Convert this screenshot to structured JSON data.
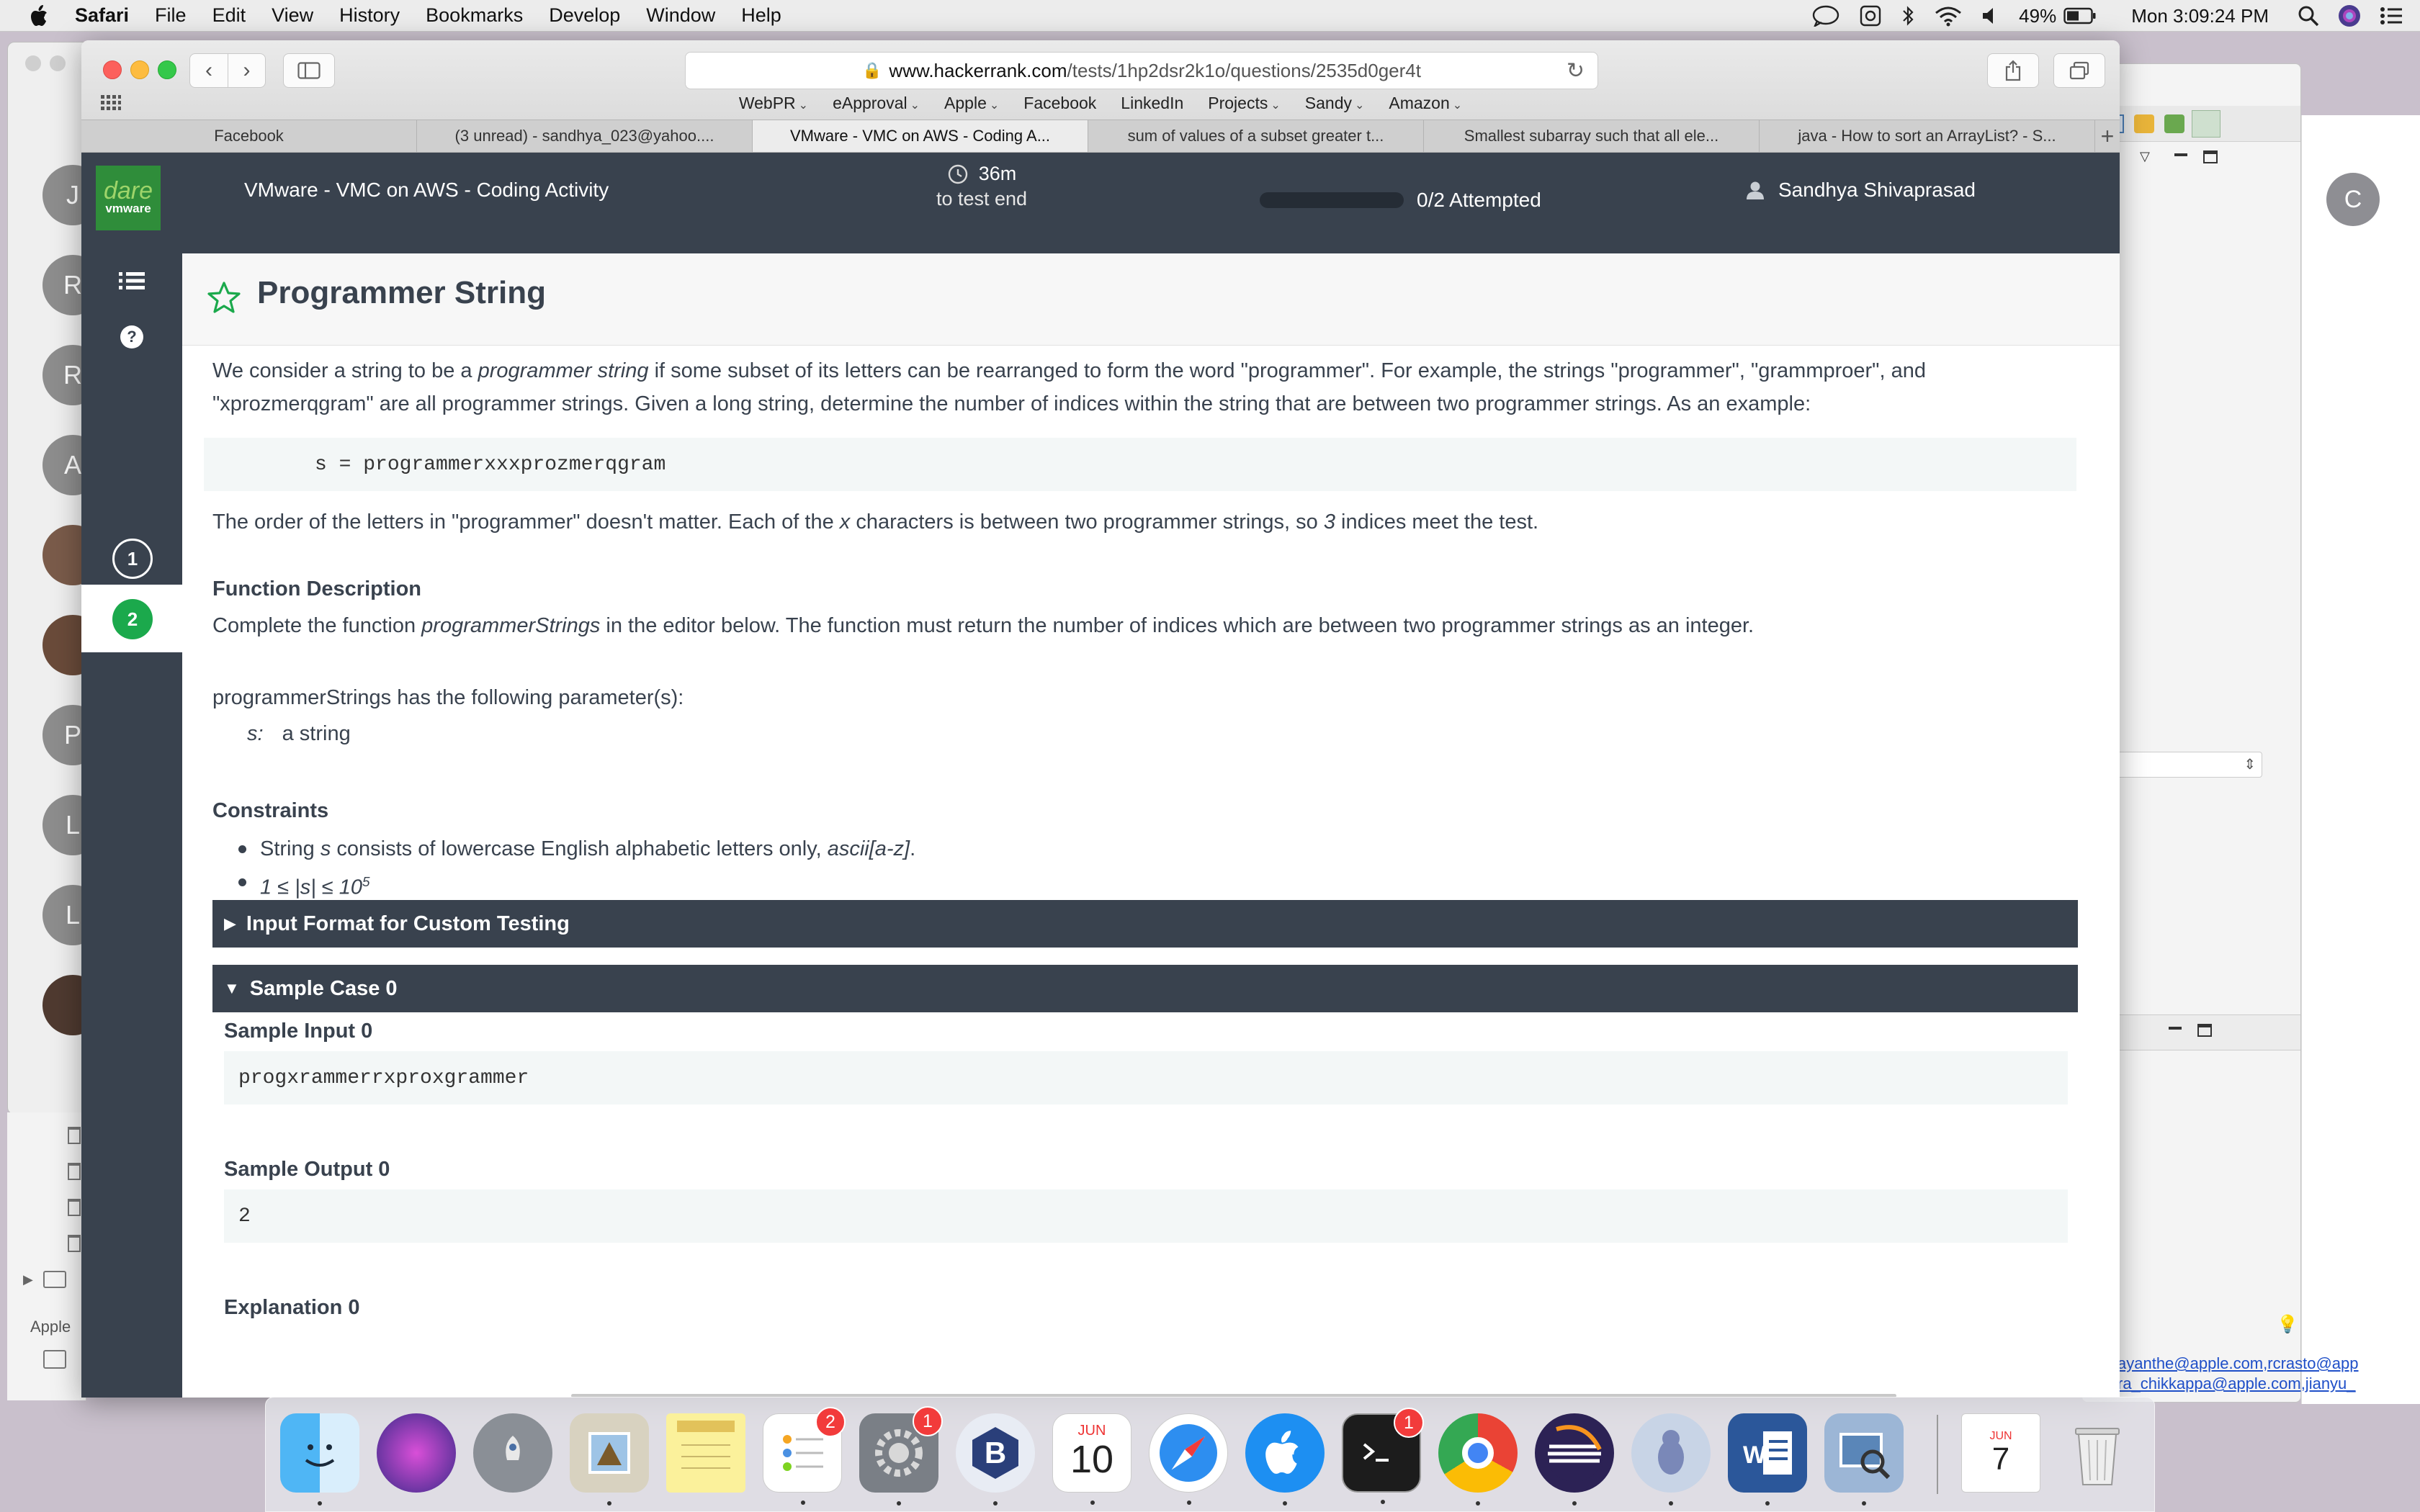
{
  "menubar": {
    "app": "Safari",
    "items": [
      "File",
      "Edit",
      "View",
      "History",
      "Bookmarks",
      "Develop",
      "Window",
      "Help"
    ],
    "battery": "49%",
    "clock": "Mon 3:09:24 PM"
  },
  "background": {
    "left_avatars": [
      "J",
      "R",
      "R",
      "A",
      "",
      "",
      "P",
      "L",
      "L",
      ""
    ],
    "apple_label": "Apple",
    "right_avatar": "C",
    "emails": [
      "ayanthe@apple.com,rcrasto@app",
      "ra_chikkappa@apple.com,jianyu_"
    ]
  },
  "browser": {
    "address_domain": "www.hackerrank.com",
    "address_path": "/tests/1hp2dsr2k1o/questions/2535d0ger4t",
    "favorites": [
      {
        "label": "WebPR",
        "menu": true
      },
      {
        "label": "eApproval",
        "menu": true
      },
      {
        "label": "Apple",
        "menu": true
      },
      {
        "label": "Facebook",
        "menu": false
      },
      {
        "label": "LinkedIn",
        "menu": false
      },
      {
        "label": "Projects",
        "menu": true
      },
      {
        "label": "Sandy",
        "menu": true
      },
      {
        "label": "Amazon",
        "menu": true
      }
    ],
    "tabs": [
      {
        "label": "Facebook",
        "active": false
      },
      {
        "label": "(3 unread) - sandhya_023@yahoo....",
        "active": false
      },
      {
        "label": "VMware - VMC on AWS - Coding A...",
        "active": true
      },
      {
        "label": "sum of values of a subset greater t...",
        "active": false
      },
      {
        "label": "Smallest subarray such that all ele...",
        "active": false
      },
      {
        "label": "java - How to sort an ArrayList? - S...",
        "active": false
      }
    ]
  },
  "header": {
    "logo_top": "dare",
    "logo_bottom": "vmware",
    "test_title": "VMware - VMC on AWS - Coding Activity",
    "timer_value": "36m",
    "timer_label": "to test end",
    "attempted": "0/2 Attempted",
    "progress_fraction": 0,
    "user_name": "Sandhya Shivaprasad"
  },
  "sidenav": {
    "q1": "1",
    "q2": "2"
  },
  "problem": {
    "title": "Programmer String",
    "intro": [
      {
        "t": "We consider a string to be a "
      },
      {
        "t": "programmer string",
        "i": true
      },
      {
        "t": " if some subset of its letters can be rearranged to form the word \"programmer\". For example, the strings \"programmer\", \"grammproer\", and \"xprozmerqgram\" are all programmer strings. Given a long string, determine the number of indices within the string that are between two programmer strings. As an example:"
      }
    ],
    "example_code": "s = programmerxxxprozmerqgram",
    "order_note": [
      {
        "t": "The order of the letters in \"programmer\" doesn't matter. Each of the "
      },
      {
        "t": "x",
        "i": true
      },
      {
        "t": " characters is between two programmer strings, so "
      },
      {
        "t": "3",
        "i": true
      },
      {
        "t": " indices meet the test."
      }
    ],
    "function_heading": "Function Description",
    "function_desc": [
      {
        "t": "Complete the function "
      },
      {
        "t": "programmerStrings",
        "i": true
      },
      {
        "t": " in the editor below. The function must return the number of indices which are between two programmer strings as an integer."
      }
    ],
    "params_intro": "programmerStrings has the following parameter(s):",
    "param_name": "s:",
    "param_desc": "a string",
    "constraints_heading": "Constraints",
    "constraints": [
      [
        {
          "t": "String "
        },
        {
          "t": "s",
          "i": true
        },
        {
          "t": " consists of lowercase English alphabetic letters only, "
        },
        {
          "t": "ascii[a-z]",
          "i": true
        },
        {
          "t": "."
        }
      ],
      [
        {
          "t": "1 ≤ |s| ≤ 10",
          "i": true
        },
        {
          "t": "5",
          "i": true,
          "sup": true
        }
      ]
    ],
    "accordion_input": "Input Format for Custom Testing",
    "accordion_sample": "Sample Case 0",
    "sample_input_heading": "Sample Input 0",
    "sample_input": "progxrammerrxproxgrammer",
    "sample_output_heading": "Sample Output 0",
    "sample_output": "2",
    "explanation_heading": "Explanation 0"
  },
  "dock": {
    "badges": {
      "reminders": "2",
      "preferences": "1",
      "terminal": "1"
    },
    "calendar_month": "JUN",
    "calendar_day": "10",
    "doc_month": "JUN",
    "doc_day": "7"
  }
}
